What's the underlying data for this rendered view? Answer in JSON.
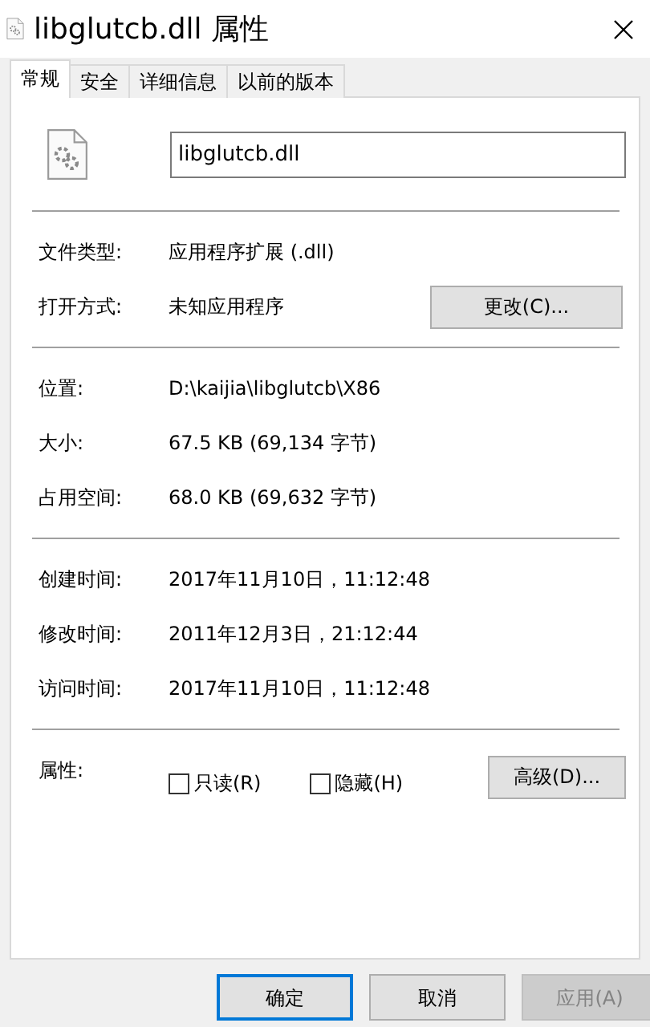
{
  "window": {
    "title": "libglutcb.dll 属性"
  },
  "tabs": [
    {
      "label": "常规",
      "selected": true
    },
    {
      "label": "安全",
      "selected": false
    },
    {
      "label": "详细信息",
      "selected": false
    },
    {
      "label": "以前的版本",
      "selected": false
    }
  ],
  "file_name": {
    "value": "libglutcb.dll"
  },
  "sections": [
    [
      {
        "label": "文件类型:",
        "value": "应用程序扩展 (.dll)"
      },
      {
        "label": "打开方式:",
        "value": "未知应用程序",
        "button": "更改(C)..."
      }
    ],
    [
      {
        "label": "位置:",
        "value": "D:\\kaijia\\libglutcb\\X86"
      },
      {
        "label": "大小:",
        "value": "67.5 KB (69,134 字节)"
      },
      {
        "label": "占用空间:",
        "value": "68.0 KB (69,632 字节)"
      }
    ],
    [
      {
        "label": "创建时间:",
        "value": "2017年11月10日，11:12:48"
      },
      {
        "label": "修改时间:",
        "value": "2011年12月3日，21:12:44"
      },
      {
        "label": "访问时间:",
        "value": "2017年11月10日，11:12:48"
      }
    ]
  ],
  "attributes": {
    "label": "属性:",
    "checkboxes": [
      {
        "label": "只读(R)",
        "checked": false
      },
      {
        "label": "隐藏(H)",
        "checked": false
      }
    ],
    "button": "高级(D)..."
  },
  "buttons": [
    {
      "label": "确定",
      "default": true,
      "disabled": false
    },
    {
      "label": "取消",
      "default": false,
      "disabled": false
    },
    {
      "label": "应用(A)",
      "default": false,
      "disabled": true
    }
  ]
}
